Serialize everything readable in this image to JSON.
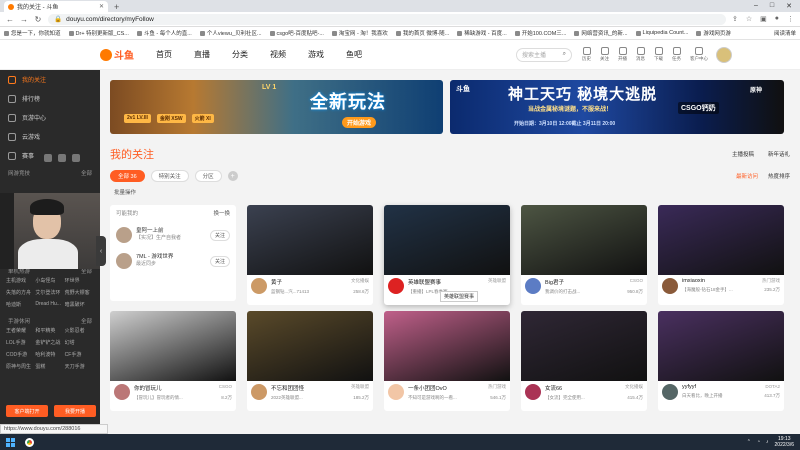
{
  "browser": {
    "tab_title": "我的关注 - 斗鱼",
    "url": "douyu.com/directory/myFollow",
    "status_url": "https://www.douyu.com/288016",
    "bookmarks": [
      "您是一下，你就知道",
      "Dr+ 特别更新版_CS...",
      "斗鱼 - 每个人的直...",
      "个人viewu_贝利社区...",
      "csgo吧-百度贴吧-...",
      "淘宝网 - 淘！我喜欢",
      "我的首页 微博-随...",
      "稀缺游戏 - 百度...",
      "开始100.COM三...",
      "网络营资讯_的新...",
      "Liquipedia Count...",
      "游戏网页游"
    ],
    "bookmark_right": "阅读清单"
  },
  "header": {
    "logo_text": "斗鱼",
    "nav": [
      "首页",
      "直播",
      "分类",
      "视频",
      "游戏",
      "鱼吧"
    ],
    "search_placeholder": "搜索主播",
    "icons": [
      {
        "name": "history-icon",
        "label": "历史"
      },
      {
        "name": "follow-icon",
        "label": "关注"
      },
      {
        "name": "open-stream-icon",
        "label": "开播"
      },
      {
        "name": "message-icon",
        "label": "消息"
      },
      {
        "name": "download-icon",
        "label": "下载"
      },
      {
        "name": "task-icon",
        "label": "任务"
      },
      {
        "name": "client-icon",
        "label": "客户中心"
      }
    ]
  },
  "sidebar": {
    "items": [
      {
        "label": "我的关注",
        "active": true,
        "icon": "heart-icon"
      },
      {
        "label": "排行榜",
        "active": false,
        "icon": "rank-icon"
      },
      {
        "label": "页游中心",
        "active": false,
        "icon": "game-center-icon"
      },
      {
        "label": "云游戏",
        "active": false,
        "icon": "cloud-game-icon"
      },
      {
        "label": "赛事",
        "active": false,
        "icon": "match-icon"
      }
    ],
    "section_online": {
      "title": "网游竞技",
      "more": "全部"
    },
    "section_single": {
      "title": "单机热游",
      "more": "全部"
    },
    "single_games": [
      "主机游戏",
      "小岛怪鸟",
      "环世界",
      "失落的方舟",
      "艾尔登法环",
      "荒野大镖客",
      "哈迪斯",
      "Dread Hu...",
      "暗黑破坏"
    ],
    "section_mobile": {
      "title": "手游休闲",
      "more": "全部"
    },
    "mobile_games": [
      "王者荣耀",
      "和平精英",
      "火影忍者",
      "LOL手游",
      "金铲铲之战",
      "幻塔",
      "COD手游",
      "哈利波特",
      "CF手游",
      "原神与周生",
      "蛋糕",
      "天刀手游"
    ],
    "bottom": [
      "客户端打开",
      "我要开播"
    ]
  },
  "banners": {
    "left": {
      "level": "LV 1",
      "title": "全新玩法",
      "button": "开始游戏",
      "tags": [
        "2v1 LV.III",
        "金刚 XSW",
        "火箭 XI"
      ]
    },
    "right": {
      "brand": "斗鱼",
      "title": "神工天巧 秘境大逃脱",
      "subtitle": "当战金属秘境谜题，不服来战！",
      "date": "开始日期：3月10日 12:00截止 3月11日 20:00",
      "tiktok": "CSGO钙奶",
      "side": "原神"
    }
  },
  "section": {
    "title": "我的关注",
    "right_links": [
      "主播投稿",
      "新年话礼"
    ]
  },
  "filters": {
    "chips": [
      {
        "label": "全部 36",
        "active": true
      },
      {
        "label": "特别关注",
        "active": false
      },
      {
        "label": "分区",
        "active": false
      }
    ],
    "right": [
      "最新访问",
      "热度排序"
    ],
    "batch": "批量操作"
  },
  "may_know": {
    "title": "可能我的",
    "swap": "换一换",
    "people": [
      {
        "name": "皇阿一上前",
        "sub": "【实况】生产自我者",
        "follow": "关注"
      },
      {
        "name": "7ML - 游戏世界",
        "sub": "最近同步",
        "follow": "关注"
      }
    ]
  },
  "cards": [
    {
      "name": "黄子",
      "category": "文化播娱",
      "title": "蓝钢钻...汽...71413",
      "hot": "258.6万",
      "thumb": "#3b4150",
      "av": "#cc9a66"
    },
    {
      "name": "英雄联盟赛事",
      "category": "英雄联盟",
      "title": "【重播】LPL春季赛...",
      "hot": "",
      "thumb": "#213246",
      "av": "#d22"
    },
    {
      "name": "Big君子",
      "category": "CSGO",
      "title": "我调价的打击战...",
      "hot": "950.8万",
      "thumb": "#4d5543",
      "av": "#5c7cc4"
    },
    {
      "name": "imxiaoxin",
      "category": "热门游戏",
      "title": "【海魔般-钻石18金手】...",
      "hot": "235.2万",
      "thumb": "#3a2a58",
      "av": "#8a5a3a"
    },
    {
      "name": "你的冒玩儿",
      "category": "CSGO",
      "title": "【冒玩儿】冒玩者的情...",
      "hot": "8.2万",
      "thumb": "#cfcfcf",
      "av": "#b77"
    },
    {
      "name": "不忘和团团怪",
      "category": "英雄联盟",
      "title": "2022英雄联盟...",
      "hot": "185.2万",
      "thumb": "#5a4a2a",
      "av": "#c96"
    },
    {
      "name": "一条小团团OvO",
      "category": "热门游戏",
      "title": "不知可是游戏啊的一看...",
      "hot": "546.1万",
      "thumb": "#c0608a",
      "av": "#f2c6a6"
    },
    {
      "name": "女流66",
      "category": "文化播娱",
      "title": "【女流】完全使用...",
      "hot": "415.4万",
      "thumb": "#2f2735",
      "av": "#a35"
    },
    {
      "name": "yyfyyf",
      "category": "DOTA2",
      "title": "白天看比，晚上开播",
      "hot": "413.7万",
      "thumb": "#4a3060",
      "av": "#566"
    }
  ],
  "hover_tip": "英雄联盟赛事",
  "taskbar": {
    "time": "19:13",
    "date": "2022/3/6"
  }
}
